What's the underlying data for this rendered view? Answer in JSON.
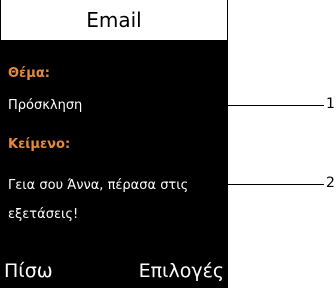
{
  "screen": {
    "title": "Email",
    "subject_label": "Θέμα:",
    "subject_value": "Πρόσκληση",
    "body_label": "Κείμενο:",
    "body_line1": "Γεια σου Άννα, πέρασα στις",
    "body_line2": "εξετάσεις!"
  },
  "softkeys": {
    "left": "Πίσω",
    "right": "Επιλογές"
  },
  "callouts": {
    "one": "1",
    "two": "2"
  },
  "colors": {
    "label_accent": "#e58a3c",
    "screen_bg": "#000000",
    "title_bg": "#ffffff"
  }
}
